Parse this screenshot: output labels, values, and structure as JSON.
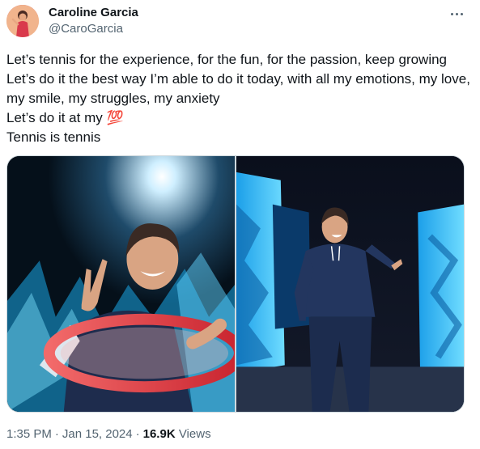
{
  "author": {
    "name": "Caroline Garcia",
    "handle": "@CaroGarcia"
  },
  "tweet": {
    "lines": [
      "Let’s tennis for the experience, for the fun, for the passion, keep growing",
      "Let’s do it the best way I’m able to do it today, with all my emotions, my love, my smile, my struggles, my anxiety",
      "Let’s do it at my 💯",
      "Tennis is tennis"
    ]
  },
  "media": {
    "photos": [
      {
        "icon": "photo-player-peace-sign-racket"
      },
      {
        "icon": "photo-player-walking-on-stage"
      }
    ]
  },
  "meta": {
    "time": "1:35 PM",
    "date": "Jan 15, 2024",
    "separator": "·",
    "views_count": "16.9K",
    "views_label": "Views"
  },
  "colors": {
    "text": "#0f1419",
    "secondary": "#536471",
    "border": "#cfd9de"
  }
}
